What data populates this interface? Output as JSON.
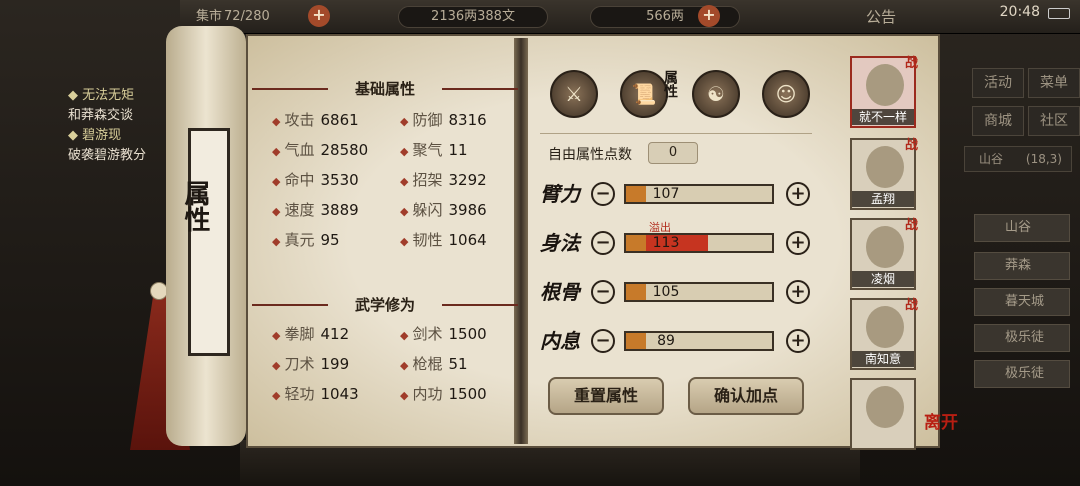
{
  "topbar": {
    "bag_partial": "集市",
    "bag_count": "72/280",
    "silver": "2136两388文",
    "gold": "566两",
    "notice": "公告",
    "clock": "20:48"
  },
  "quest": {
    "items": [
      {
        "title": "无法无矩",
        "desc": "和莽森交谈"
      },
      {
        "title": "碧游现",
        "desc": "破袭碧游教分"
      }
    ]
  },
  "scroll": {
    "tab_title": "属性"
  },
  "basic_section": {
    "title": "基础属性",
    "stats": [
      {
        "name": "攻击",
        "value": "6861"
      },
      {
        "name": "防御",
        "value": "8316"
      },
      {
        "name": "气血",
        "value": "28580"
      },
      {
        "name": "聚气",
        "value": "11"
      },
      {
        "name": "命中",
        "value": "3530"
      },
      {
        "name": "招架",
        "value": "3292"
      },
      {
        "name": "速度",
        "value": "3889"
      },
      {
        "name": "躲闪",
        "value": "3986"
      },
      {
        "name": "真元",
        "value": "95"
      },
      {
        "name": "韧性",
        "value": "1064"
      }
    ]
  },
  "martial_section": {
    "title": "武学修为",
    "stats": [
      {
        "name": "拳脚",
        "value": "412"
      },
      {
        "name": "剑术",
        "value": "1500"
      },
      {
        "name": "刀术",
        "value": "199"
      },
      {
        "name": "枪棍",
        "value": "51"
      },
      {
        "name": "轻功",
        "value": "1043"
      },
      {
        "name": "内功",
        "value": "1500"
      }
    ]
  },
  "attr_panel": {
    "tab_label": "属性",
    "free_points_label": "自由属性点数",
    "free_points": "0",
    "overflow_label": "溢出",
    "attrs": [
      {
        "label": "臂力",
        "value": "107",
        "fill": 0.14,
        "over": 0
      },
      {
        "label": "身法",
        "value": "113",
        "fill": 0.14,
        "over": 0.42
      },
      {
        "label": "根骨",
        "value": "105",
        "fill": 0.14,
        "over": 0
      },
      {
        "label": "内息",
        "value": "89",
        "fill": 0.14,
        "over": 0
      }
    ],
    "reset_label": "重置属性",
    "confirm_label": "确认加点"
  },
  "party": {
    "battle_mark": "战",
    "members": [
      {
        "name": "就不一样",
        "battle": true
      },
      {
        "name": "孟翔",
        "battle": true
      },
      {
        "name": "凌烟",
        "battle": true
      },
      {
        "name": "南知意",
        "battle": true
      },
      {
        "name": "",
        "battle": false
      }
    ],
    "leave_label": "离开"
  },
  "side_menu": {
    "buttons": [
      "活动",
      "菜单",
      "商城",
      "社区"
    ],
    "location": "山谷",
    "location_coords": "(18,3)",
    "npcs": [
      "山谷",
      "莽森",
      "暮天城",
      "极乐徒",
      "极乐徒"
    ]
  },
  "colors": {
    "accent_red": "#a03c2a",
    "bar_fill": "#c77a2a",
    "overflow": "#c63420"
  }
}
